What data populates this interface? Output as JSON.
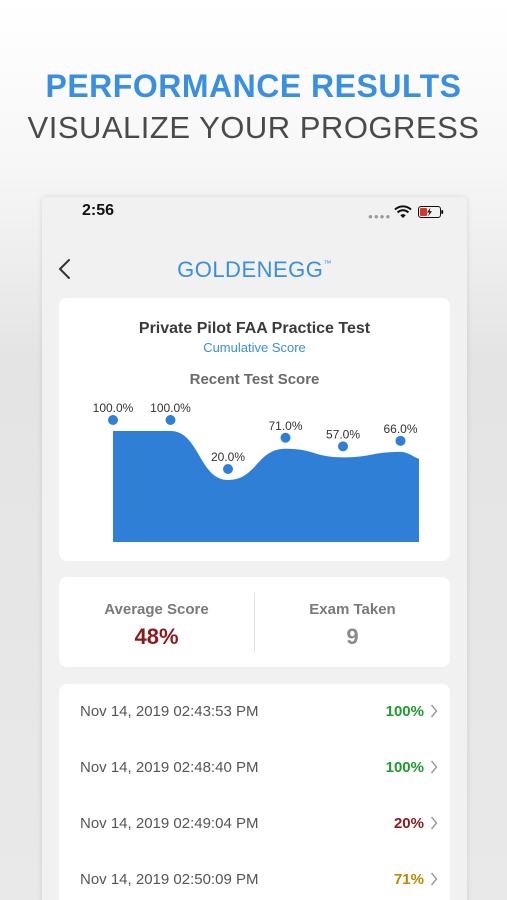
{
  "promo": {
    "headline": "PERFORMANCE RESULTS",
    "subheadline": "VISUALIZE YOUR PROGRESS"
  },
  "status_bar": {
    "time": "2:56",
    "signal": "●●●●",
    "icons": [
      "wifi-icon",
      "battery-charging-icon"
    ]
  },
  "nav": {
    "back_icon": "chevron-left-icon",
    "logo_text": "GOLDENEGG",
    "logo_mark": "™"
  },
  "chart_card": {
    "title": "Private Pilot FAA Practice Test",
    "subtitle": "Cumulative Score"
  },
  "chart_data": {
    "type": "area",
    "title": "Recent Test Score",
    "xlabel": "",
    "ylabel": "",
    "ylim": [
      0,
      100
    ],
    "grid": false,
    "series": [
      {
        "values": [
          100,
          100,
          20,
          71,
          57,
          66
        ],
        "labels": [
          "100.0%",
          "100.0%",
          "20.0%",
          "71.0%",
          "57.0%",
          "66.0%"
        ]
      }
    ],
    "colors": {
      "fill": "#2f7fd6",
      "point": "#2f7fd6",
      "label": "#333333"
    }
  },
  "stats": {
    "average_label": "Average Score",
    "average_value": "48%",
    "exams_label": "Exam Taken",
    "exams_value": "9"
  },
  "results": [
    {
      "date": "Nov 14, 2019 02:43:53 PM",
      "score": "100%",
      "color": "#1e9a2e"
    },
    {
      "date": "Nov 14, 2019 02:48:40 PM",
      "score": "100%",
      "color": "#1e9a2e"
    },
    {
      "date": "Nov 14, 2019 02:49:04 PM",
      "score": "20%",
      "color": "#8b1a1a"
    },
    {
      "date": "Nov 14, 2019 02:50:09 PM",
      "score": "71%",
      "color": "#b38a00"
    }
  ],
  "colors": {
    "accent": "#3a8fde",
    "danger": "#8b1a1a",
    "success": "#1e9a2e",
    "warning": "#b38a00"
  }
}
